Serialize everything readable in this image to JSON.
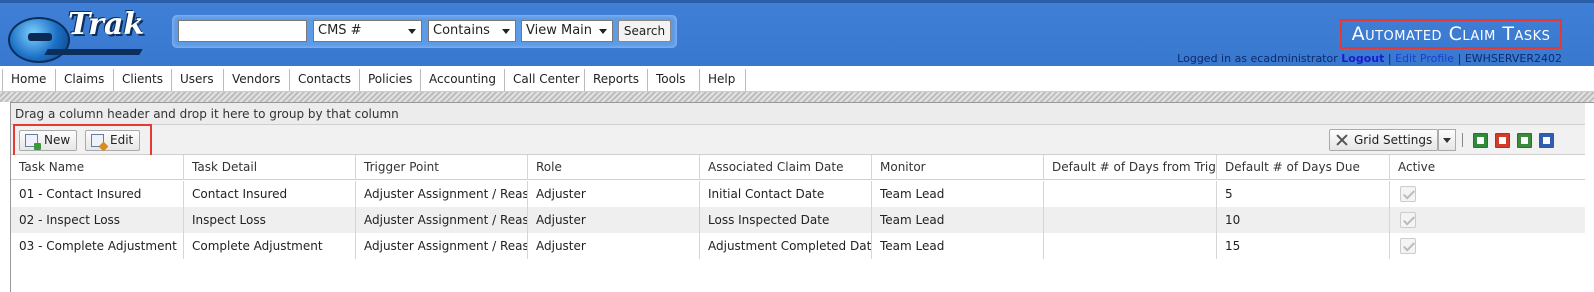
{
  "logo": {
    "text": "Trak"
  },
  "search": {
    "input_value": "",
    "field_select": "CMS #",
    "operator_select": "Contains",
    "view_select": "View Main",
    "button_label": "Search"
  },
  "page_title": "Automated Claim Tasks",
  "login": {
    "prefix": "Logged in as ecadministrator",
    "logout": "Logout",
    "sep1": "|",
    "edit_profile": "Edit Profile",
    "sep2": "|",
    "server": "EWHSERVER2402"
  },
  "nav": {
    "items": [
      {
        "label": "Home"
      },
      {
        "label": "Claims"
      },
      {
        "label": "Clients"
      },
      {
        "label": "Users"
      },
      {
        "label": "Vendors"
      },
      {
        "label": "Contacts"
      },
      {
        "label": "Policies"
      },
      {
        "label": "Accounting"
      },
      {
        "label": "Call Center"
      },
      {
        "label": "Reports"
      },
      {
        "label": "Tools"
      },
      {
        "label": "Help"
      }
    ]
  },
  "grid": {
    "group_hint": "Drag a column header and drop it here to group by that column",
    "toolbar": {
      "new_label": "New",
      "edit_label": "Edit",
      "grid_settings_label": "Grid Settings"
    },
    "export_icons": [
      "excel-export-icon",
      "pdf-export-icon",
      "csv-export-icon",
      "word-export-icon"
    ],
    "columns": [
      "Task Name",
      "Task Detail",
      "Trigger Point",
      "Role",
      "Associated Claim Date",
      "Monitor",
      "Default # of Days from Trigger Point",
      "Default # of Days Due",
      "Active"
    ],
    "rows": [
      [
        "01 - Contact Insured",
        "Contact Insured",
        "Adjuster Assignment / Reassignment",
        "Adjuster",
        "Initial Contact Date",
        "Team Lead",
        "",
        "5",
        "checked"
      ],
      [
        "02 - Inspect Loss",
        "Inspect Loss",
        "Adjuster Assignment / Reassignment",
        "Adjuster",
        "Loss Inspected Date",
        "Team Lead",
        "",
        "10",
        "checked"
      ],
      [
        "03 - Complete Adjustment",
        "Complete Adjustment",
        "Adjuster Assignment / Reassignment",
        "Adjuster",
        "Adjustment Completed Date",
        "Team Lead",
        "",
        "15",
        "checked"
      ]
    ]
  },
  "colors": {
    "header_blue": "#3b7bd2",
    "highlight_red": "#e53935",
    "alt_row": "#efefef"
  }
}
